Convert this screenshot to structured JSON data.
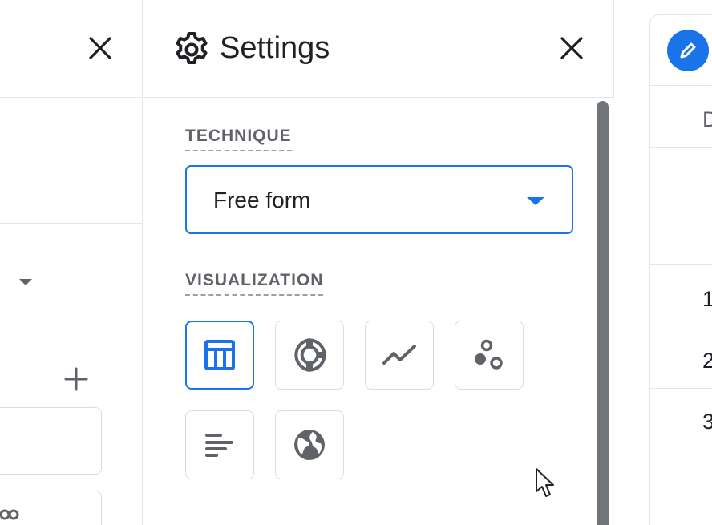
{
  "left_panel": {
    "close_icon": "close-icon",
    "add_icon": "plus-icon",
    "dropdown_icon": "caret-down-icon"
  },
  "settings": {
    "title": "Settings",
    "header_icon": "gear-icon",
    "close_icon": "close-icon",
    "technique": {
      "label": "TECHNIQUE",
      "selected": "Free form"
    },
    "visualization": {
      "label": "VISUALIZATION",
      "options": [
        {
          "name": "table",
          "icon": "table-icon",
          "selected": true
        },
        {
          "name": "donut-chart",
          "icon": "donut-chart-icon",
          "selected": false
        },
        {
          "name": "line-chart",
          "icon": "line-chart-icon",
          "selected": false
        },
        {
          "name": "scatter-plot",
          "icon": "scatter-plot-icon",
          "selected": false
        },
        {
          "name": "bar-chart",
          "icon": "bar-chart-icon",
          "selected": false
        },
        {
          "name": "geo-map",
          "icon": "globe-icon",
          "selected": false
        }
      ]
    }
  },
  "right_panel": {
    "edit_icon": "pencil-icon",
    "column_header": "D",
    "rows": [
      "1",
      "2",
      "3"
    ]
  },
  "colors": {
    "accent": "#1a73e8",
    "icon_gray": "#5f6368",
    "border": "#dadce0"
  }
}
